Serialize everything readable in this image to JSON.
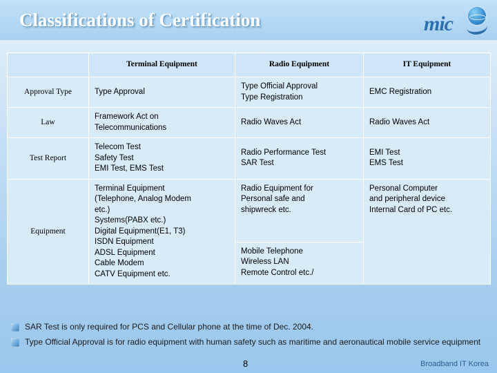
{
  "slide": {
    "title": "Classifications of Certification",
    "page_number": "8",
    "footer_right": "Broadband IT Korea",
    "logo": {
      "text": "mic",
      "globe_icon": "globe-icon",
      "arc_icon": "arc-swoosh-icon"
    }
  },
  "table": {
    "headers": [
      "",
      "Terminal Equipment",
      "Radio Equipment",
      "IT Equipment"
    ],
    "rows": [
      {
        "label": "Approval Type",
        "terminal": [
          "Type Approval"
        ],
        "radio": [
          "Type Official Approval",
          "Type Registration"
        ],
        "it": [
          "EMC Registration"
        ]
      },
      {
        "label": "Law",
        "terminal": [
          "Framework Act on",
          "Telecommunications"
        ],
        "radio": [
          "Radio Waves Act"
        ],
        "it": [
          "Radio Waves Act"
        ]
      },
      {
        "label": "Test Report",
        "terminal": [
          "Telecom Test",
          "Safety Test",
          "EMI Test, EMS Test"
        ],
        "radio": [
          "Radio Performance Test",
          "SAR Test"
        ],
        "it": [
          "EMI Test",
          "EMS Test"
        ]
      },
      {
        "label": "Equipment",
        "terminal": [
          "Terminal Equipment",
          "(Telephone, Analog Modem",
          "etc.)",
          "Systems(PABX etc.)",
          "Digital Equipment(E1, T3)",
          "ISDN Equipment",
          "ADSL Equipment",
          "Cable Modem",
          "CATV Equipment etc."
        ],
        "radio_top": [
          "Radio Equipment for",
          "Personal safe and",
          "shipwreck etc."
        ],
        "radio_bottom": [
          "Mobile Telephone",
          "Wireless LAN",
          "Remote Control etc./"
        ],
        "it": [
          "Personal Computer",
          "and peripheral device",
          "Internal Card of PC etc."
        ]
      }
    ]
  },
  "bullets": [
    "SAR Test is only required for PCS and Cellular phone at the time of Dec. 2004.",
    "Type Official Approval is for radio equipment with human safety such as maritime and aeronautical mobile service equipment"
  ],
  "colors": {
    "title_text": "#ffffff",
    "header_cell_bg": "#cfe6f8",
    "cell_bg": "#d7ebf9",
    "label_text": "#2b6ea8",
    "header_text": "#1d4f7c",
    "logo_blue": "#2e6fae"
  }
}
